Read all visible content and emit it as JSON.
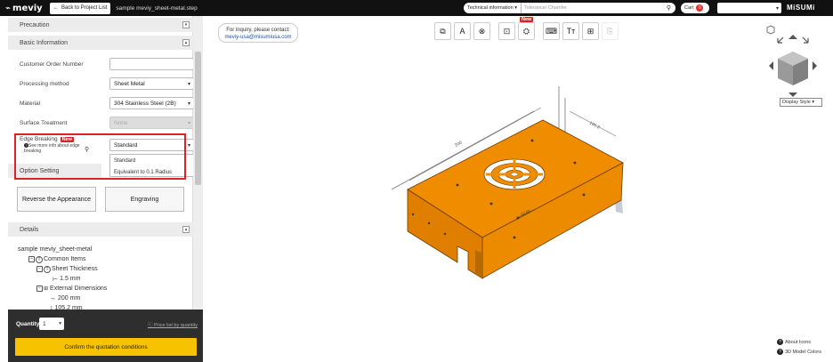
{
  "header": {
    "logo": "meviy",
    "back_label": "Back to Project List",
    "filename": "sample meviy_sheet-metal.step",
    "search_category": "Technical information",
    "search_placeholder": "Tolerance/ Chamfer",
    "cart_label": "Cart",
    "cart_count": "0",
    "brand": "MiSUMi"
  },
  "sidebar": {
    "precaution": "Precaution",
    "basic_info": "Basic Information",
    "fields": [
      {
        "label": "Customer Order Number",
        "value": ""
      },
      {
        "label": "Processing method",
        "value": "Sheet Metal"
      },
      {
        "label": "Material",
        "value": "304 Stainless Steel (2B)"
      },
      {
        "label": "Surface Treatment",
        "value": "None"
      },
      {
        "label": "Edge Breaking",
        "value": "Standard"
      }
    ],
    "edge_new_badge": "New",
    "edge_help": "See more info about edge breaking",
    "edge_options": [
      "Standard",
      "Equivalent to 0.1 Radius"
    ],
    "option_setting": "Option Setting",
    "reverse_btn": "Reverse the Appearance",
    "engraving_btn": "Engraving",
    "details": "Details",
    "tree": {
      "root": "sample meviy_sheet-metal",
      "common": "Common Items",
      "thickness": "Sheet Thickness",
      "thickness_val": "1.5 mm",
      "dims": "External Dimensions",
      "dim1": "200 mm",
      "dim2": "105.2 mm"
    }
  },
  "footer": {
    "qty_label": "Quantity",
    "qty_value": "1",
    "price_link": "Price list by quantity",
    "confirm": "Confirm the quotation conditions"
  },
  "viewer": {
    "inquiry_line1": "For inquiry, please contact:",
    "inquiry_email": "meviy-usa@misumiusa.com",
    "toolbar_new": "New",
    "display_style": "Display Style",
    "about_icons": "About Icons",
    "model_colors": "3D Model Colors",
    "dim_labels": [
      "200",
      "105.2",
      "22.86"
    ],
    "model_color": "#f08c00"
  }
}
